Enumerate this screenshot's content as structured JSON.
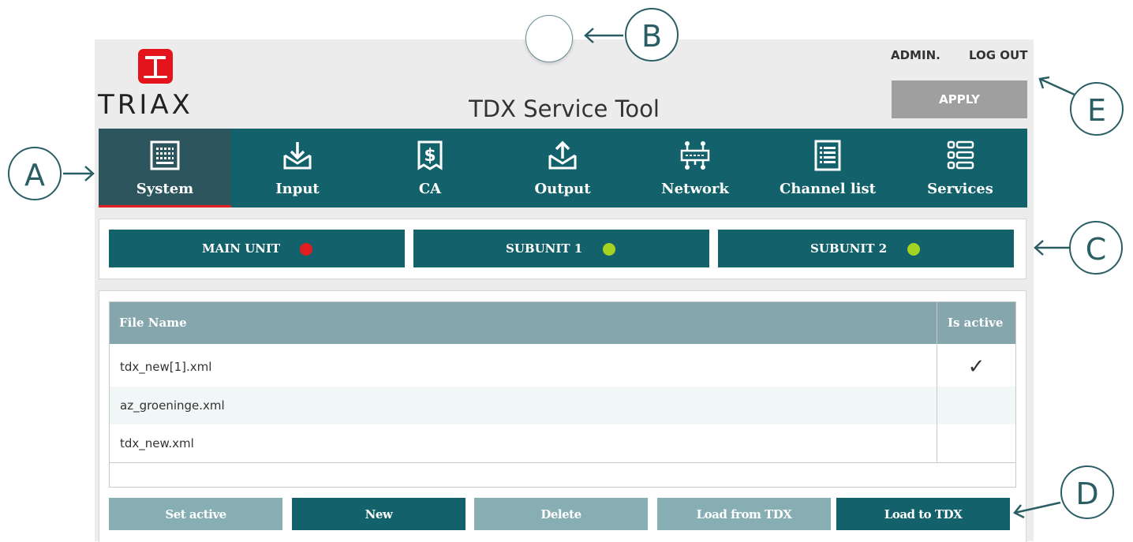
{
  "header": {
    "logo_text": "TRIAX",
    "title": "TDX Service Tool",
    "admin_label": "ADMIN.",
    "logout_label": "LOG OUT",
    "apply_label": "APPLY"
  },
  "nav": {
    "items": [
      {
        "label": "System",
        "icon": "system-icon",
        "active": true
      },
      {
        "label": "Input",
        "icon": "download-icon",
        "active": false
      },
      {
        "label": "CA",
        "icon": "dollar-icon",
        "active": false
      },
      {
        "label": "Output",
        "icon": "upload-icon",
        "active": false
      },
      {
        "label": "Network",
        "icon": "network-icon",
        "active": false
      },
      {
        "label": "Channel list",
        "icon": "list-icon",
        "active": false
      },
      {
        "label": "Services",
        "icon": "services-icon",
        "active": false
      }
    ]
  },
  "units": [
    {
      "label": "MAIN UNIT",
      "status": "red",
      "status_color": "#e02020"
    },
    {
      "label": "SUBUNIT 1",
      "status": "green",
      "status_color": "#a4d321"
    },
    {
      "label": "SUBUNIT 2",
      "status": "green",
      "status_color": "#a4d321"
    }
  ],
  "files": {
    "columns": [
      "File Name",
      "Is active"
    ],
    "rows": [
      {
        "name": "tdx_new[1].xml",
        "active": true,
        "mark": "✓"
      },
      {
        "name": "az_groeninge.xml",
        "active": false,
        "mark": ""
      },
      {
        "name": "tdx_new.xml",
        "active": false,
        "mark": ""
      }
    ]
  },
  "actions": {
    "set_active": "Set active",
    "new": "New",
    "delete": "Delete",
    "load_from": "Load from TDX",
    "load_to": "Load to TDX"
  },
  "callouts": {
    "a": "A",
    "b": "B",
    "c": "C",
    "d": "D",
    "e": "E"
  },
  "colors": {
    "accent": "#12616b",
    "active_nav": "#2d555e",
    "table_header": "#85a6ad",
    "logo_red": "#e3141b",
    "apply_gray": "#9f9f9f"
  }
}
